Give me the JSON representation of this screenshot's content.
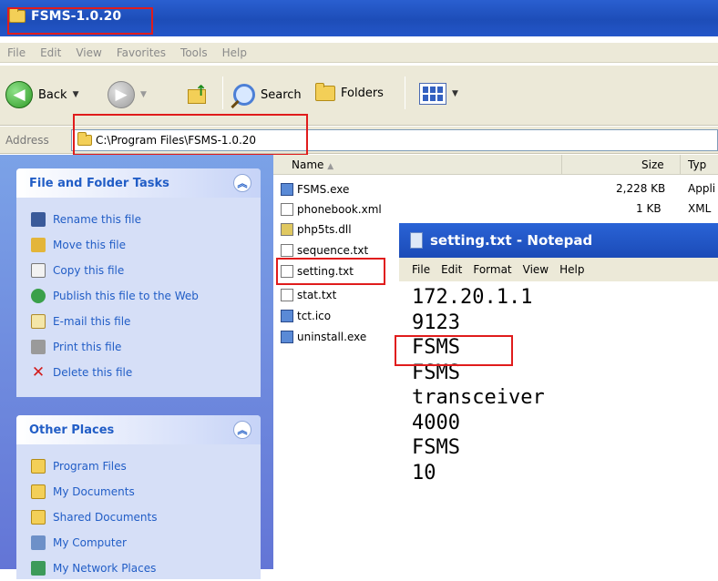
{
  "window": {
    "title": "FSMS-1.0.20"
  },
  "menu": [
    "File",
    "Edit",
    "View",
    "Favorites",
    "Tools",
    "Help"
  ],
  "toolbar": {
    "back": "Back",
    "search": "Search",
    "folders": "Folders"
  },
  "address": {
    "label": "Address",
    "path": "C:\\Program Files\\FSMS-1.0.20"
  },
  "tasks": {
    "title": "File and Folder Tasks",
    "items": [
      "Rename this file",
      "Move this file",
      "Copy this file",
      "Publish this file to the Web",
      "E-mail this file",
      "Print this file",
      "Delete this file"
    ]
  },
  "places": {
    "title": "Other Places",
    "items": [
      "Program Files",
      "My Documents",
      "Shared Documents",
      "My Computer",
      "My Network Places"
    ]
  },
  "columns": {
    "name": "Name",
    "size": "Size",
    "type": "Typ"
  },
  "files": [
    {
      "name": "FSMS.exe",
      "size": "2,228 KB",
      "type": "Appli"
    },
    {
      "name": "phonebook.xml",
      "size": "1 KB",
      "type": "XML"
    },
    {
      "name": "php5ts.dll",
      "size": "",
      "type": ""
    },
    {
      "name": "sequence.txt",
      "size": "",
      "type": ""
    },
    {
      "name": "setting.txt",
      "size": "",
      "type": ""
    },
    {
      "name": "stat.txt",
      "size": "",
      "type": ""
    },
    {
      "name": "tct.ico",
      "size": "",
      "type": ""
    },
    {
      "name": "uninstall.exe",
      "size": "",
      "type": ""
    }
  ],
  "notepad": {
    "title": "setting.txt - Notepad",
    "menu": [
      "File",
      "Edit",
      "Format",
      "View",
      "Help"
    ],
    "lines": [
      "172.20.1.1",
      "9123",
      "FSMS",
      "FSMS",
      "transceiver",
      "4000",
      "FSMS",
      "10"
    ]
  },
  "colors": {
    "highlight": "#e01c1c",
    "link": "#215dc6",
    "titlebar": "#1d4db8"
  }
}
